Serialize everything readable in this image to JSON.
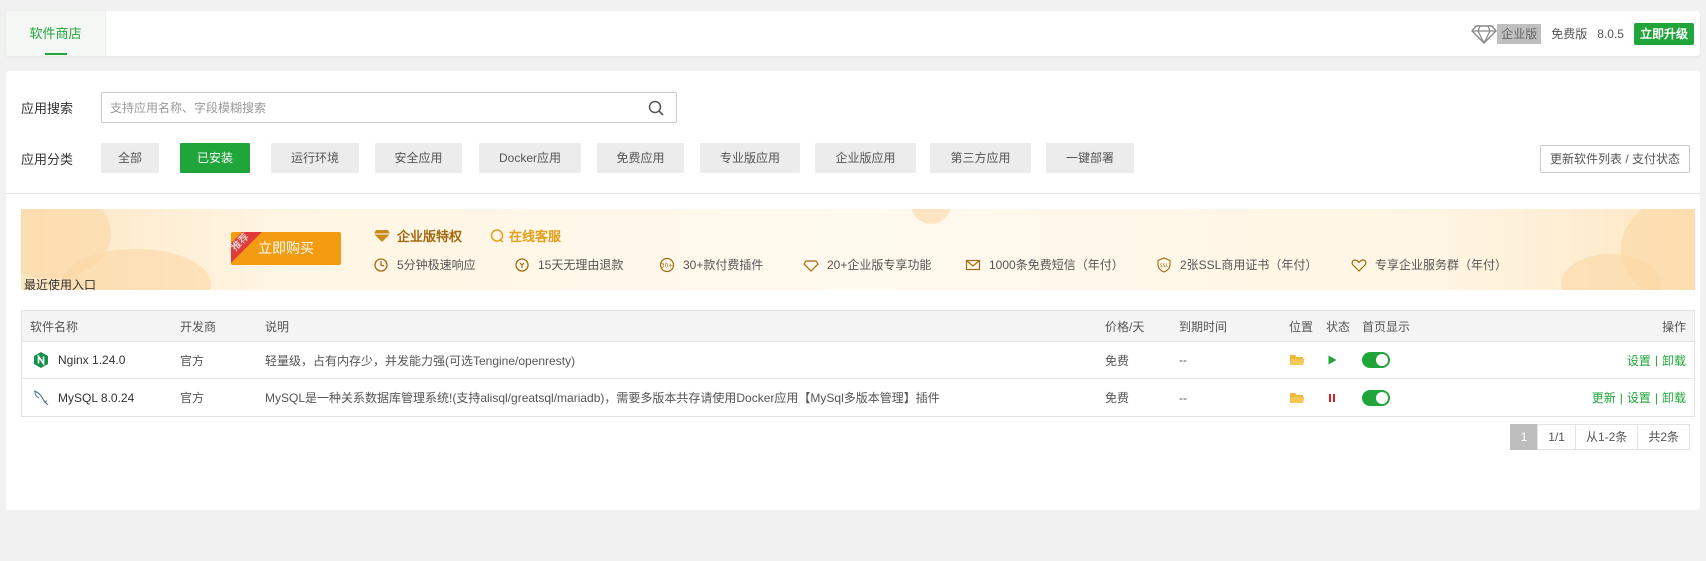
{
  "topbar": {
    "tab_label": "软件商店",
    "edition_badge": "企业版",
    "free_label": "免费版",
    "version": "8.0.5",
    "upgrade_label": "立即升级"
  },
  "search": {
    "label": "应用搜索",
    "placeholder": "支持应用名称、字段模糊搜索"
  },
  "categories": {
    "label": "应用分类",
    "items": [
      "全部",
      "已安装",
      "运行环境",
      "安全应用",
      "Docker应用",
      "免费应用",
      "专业版应用",
      "企业版应用",
      "第三方应用",
      "一键部署"
    ],
    "active_index": 1,
    "refresh_label": "更新软件列表 / 支付状态"
  },
  "banner": {
    "ribbon": "推荐",
    "buy_label": "立即购买",
    "title": "企业版特权",
    "support": "在线客服",
    "features": [
      "5分钟极速响应",
      "15天无理由退款",
      "30+款付费插件",
      "20+企业版专享功能",
      "1000条免费短信（年付）",
      "2张SSL商用证书（年付）",
      "专享企业服务群（年付）"
    ]
  },
  "recent_label": "最近使用入口",
  "table": {
    "headers": {
      "name": "软件名称",
      "dev": "开发商",
      "desc": "说明",
      "price": "价格/天",
      "expire": "到期时间",
      "location": "位置",
      "status": "状态",
      "home": "首页显示",
      "ops": "操作"
    },
    "rows": [
      {
        "name": "Nginx 1.24.0",
        "dev": "官方",
        "desc": "轻量级，占有内存少，并发能力强(可选Tengine/openresty)",
        "price": "免费",
        "expire": "--",
        "ops": [
          "设置",
          "卸载"
        ]
      },
      {
        "name": "MySQL 8.0.24",
        "dev": "官方",
        "desc": "MySQL是一种关系数据库管理系统!(支持alisql/greatsql/mariadb)，需要多版本共存请使用Docker应用【MySql多版本管理】插件",
        "price": "免费",
        "expire": "--",
        "ops": [
          "更新",
          "设置",
          "卸载"
        ]
      }
    ]
  },
  "pager": {
    "current": "1",
    "pages": "1/1",
    "range": "从1-2条",
    "total": "共2条"
  },
  "colors": {
    "brand": "#20a53a",
    "buy": "#f39c12",
    "stopped": "#e02020"
  }
}
